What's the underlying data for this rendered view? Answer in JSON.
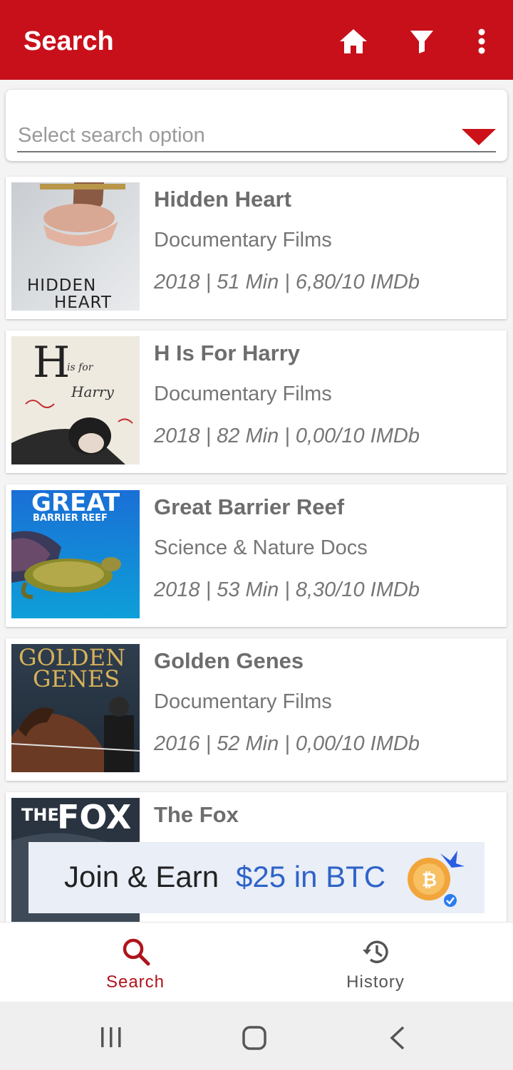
{
  "appbar": {
    "title": "Search",
    "icons": [
      "home-icon",
      "filter-icon",
      "more-vert-icon"
    ],
    "color": "#c8101b"
  },
  "search": {
    "placeholder": "Select search option"
  },
  "results": [
    {
      "title": "Hidden Heart",
      "genre": "Documentary Films",
      "meta": "2018 | 51 Min | 6,80/10 IMDb",
      "poster_text": [
        "HIDDEN",
        "HEART"
      ]
    },
    {
      "title": "H Is For Harry",
      "genre": "Documentary Films",
      "meta": "2018 | 82 Min | 0,00/10 IMDb",
      "poster_text": [
        "H",
        "is for",
        "Harry"
      ]
    },
    {
      "title": "Great Barrier Reef",
      "genre": "Science & Nature Docs",
      "meta": "2018 | 53 Min | 8,30/10 IMDb",
      "poster_text": [
        "GREAT",
        "BARRIER REEF"
      ]
    },
    {
      "title": "Golden Genes",
      "genre": "Documentary Films",
      "meta": "2016 | 52 Min | 0,00/10 IMDb",
      "poster_text": [
        "GOLDEN",
        "GENES"
      ]
    },
    {
      "title": "The Fox",
      "genre": "",
      "meta": "",
      "poster_text": [
        "THE",
        "FOX"
      ]
    }
  ],
  "ad": {
    "text": "Join & Earn",
    "highlight": "$25 in BTC"
  },
  "bottom_nav": {
    "tabs": [
      {
        "label": "Search",
        "icon": "search-icon",
        "active": true
      },
      {
        "label": "History",
        "icon": "history-icon",
        "active": false
      }
    ],
    "active_color": "#b0131b"
  },
  "system_nav": [
    "recents-icon",
    "home-icon",
    "back-icon"
  ]
}
